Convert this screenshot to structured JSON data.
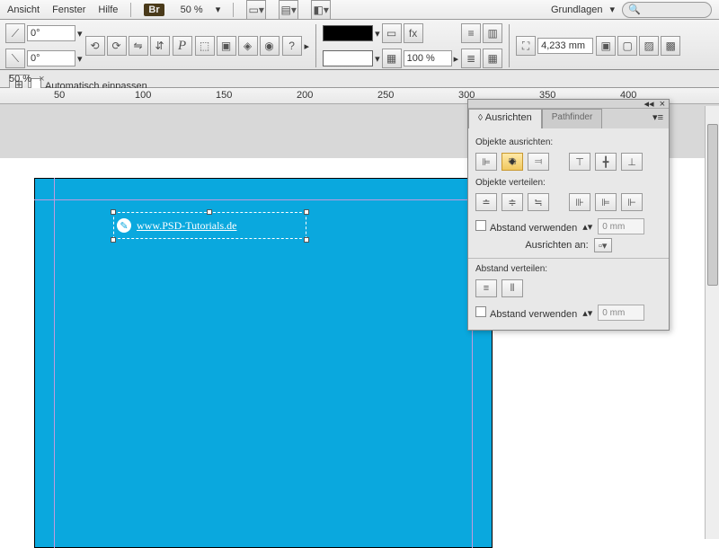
{
  "menu": {
    "ansicht": "Ansicht",
    "fenster": "Fenster",
    "hilfe": "Hilfe",
    "br": "Br",
    "zoom": "50 %",
    "workspace": "Grundlagen"
  },
  "toolbar": {
    "angle1": "0°",
    "angle2": "0°",
    "pct": "100 %",
    "measure": "4,233 mm",
    "auto_fit": "Automatisch einpassen"
  },
  "doc": {
    "zoom": "50 %",
    "close": "×"
  },
  "ruler": {
    "m50": "50",
    "m100": "100",
    "m150": "150",
    "m200": "200",
    "m250": "250",
    "m300": "300",
    "m350": "350",
    "m400": "400"
  },
  "canvas": {
    "url": "www.PSD-Tutorials.de"
  },
  "panel": {
    "tab1": "Ausrichten",
    "tab2": "Pathfinder",
    "sec1": "Objekte ausrichten:",
    "sec2": "Objekte verteilen:",
    "use_spacing": "Abstand verwenden",
    "spacing_val": "0 mm",
    "align_to": "Ausrichten an:",
    "sec3": "Abstand verteilen:"
  }
}
